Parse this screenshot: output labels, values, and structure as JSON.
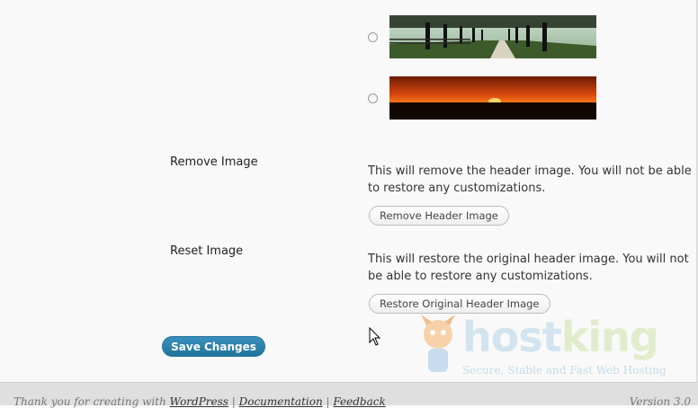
{
  "header_choices": [
    {
      "name": "tree-lined-path",
      "selected": false
    },
    {
      "name": "sunset",
      "selected": false
    }
  ],
  "remove_image": {
    "label": "Remove Image",
    "description": "This will remove the header image. You will not be able to restore any customizations.",
    "button": "Remove Header Image"
  },
  "reset_image": {
    "label": "Reset Image",
    "description": "This will restore the original header image. You will not be able to restore any customizations.",
    "button": "Restore Original Header Image"
  },
  "save_button": "Save Changes",
  "footer": {
    "thanks_prefix": "Thank you for creating with ",
    "wordpress_link": "WordPress",
    "separator1": " | ",
    "documentation_link": "Documentation",
    "separator2": " | ",
    "feedback_link": "Feedback",
    "version": "Version 3.0"
  },
  "watermark": {
    "brand_a": "host",
    "brand_b": "king",
    "tagline": "Secure, Stable and Fast Web Hosting"
  },
  "colors": {
    "accent": "#21759b",
    "background": "#f9f9f9",
    "footer": "#dfdfdf"
  }
}
